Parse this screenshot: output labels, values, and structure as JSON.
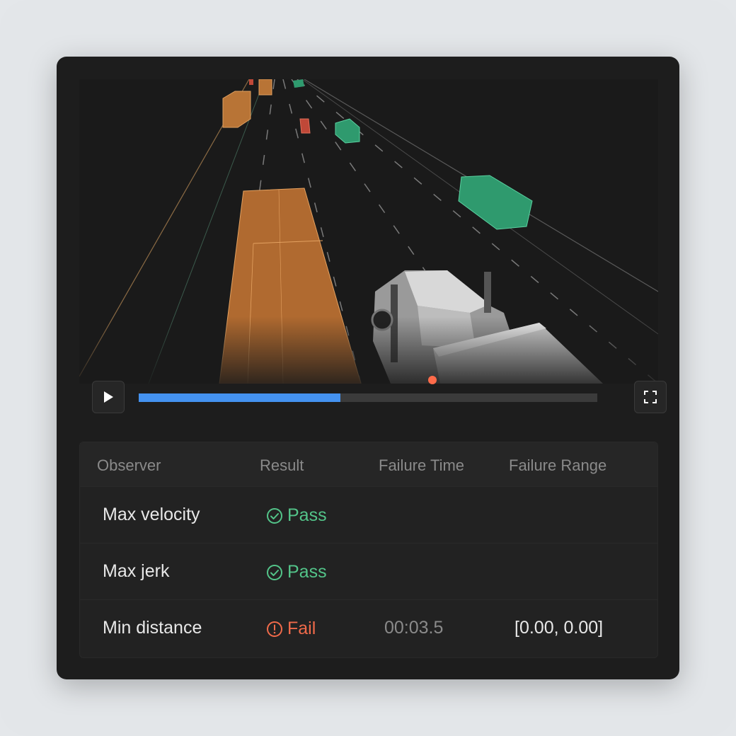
{
  "player": {
    "progress": 0.44,
    "event_marker_progress": 0.64,
    "colors": {
      "progress": "#4492f0",
      "marker": "#ff6b4a",
      "pass": "#53c489",
      "fail": "#f06a4a"
    }
  },
  "table": {
    "headers": [
      "Observer",
      "Result",
      "Failure Time",
      "Failure Range"
    ],
    "rows": [
      {
        "observer": "Max velocity",
        "result": "Pass",
        "status": "pass",
        "failure_time": "",
        "failure_range": ""
      },
      {
        "observer": "Max jerk",
        "result": "Pass",
        "status": "pass",
        "failure_time": "",
        "failure_range": ""
      },
      {
        "observer": "Min distance",
        "result": "Fail",
        "status": "fail",
        "failure_time": "00:03.5",
        "failure_range": "[0.00, 0.00]"
      }
    ]
  },
  "icons": {
    "play": "play-icon",
    "fullscreen": "fullscreen-icon",
    "pass": "check-circle-icon",
    "fail": "alert-circle-icon"
  }
}
